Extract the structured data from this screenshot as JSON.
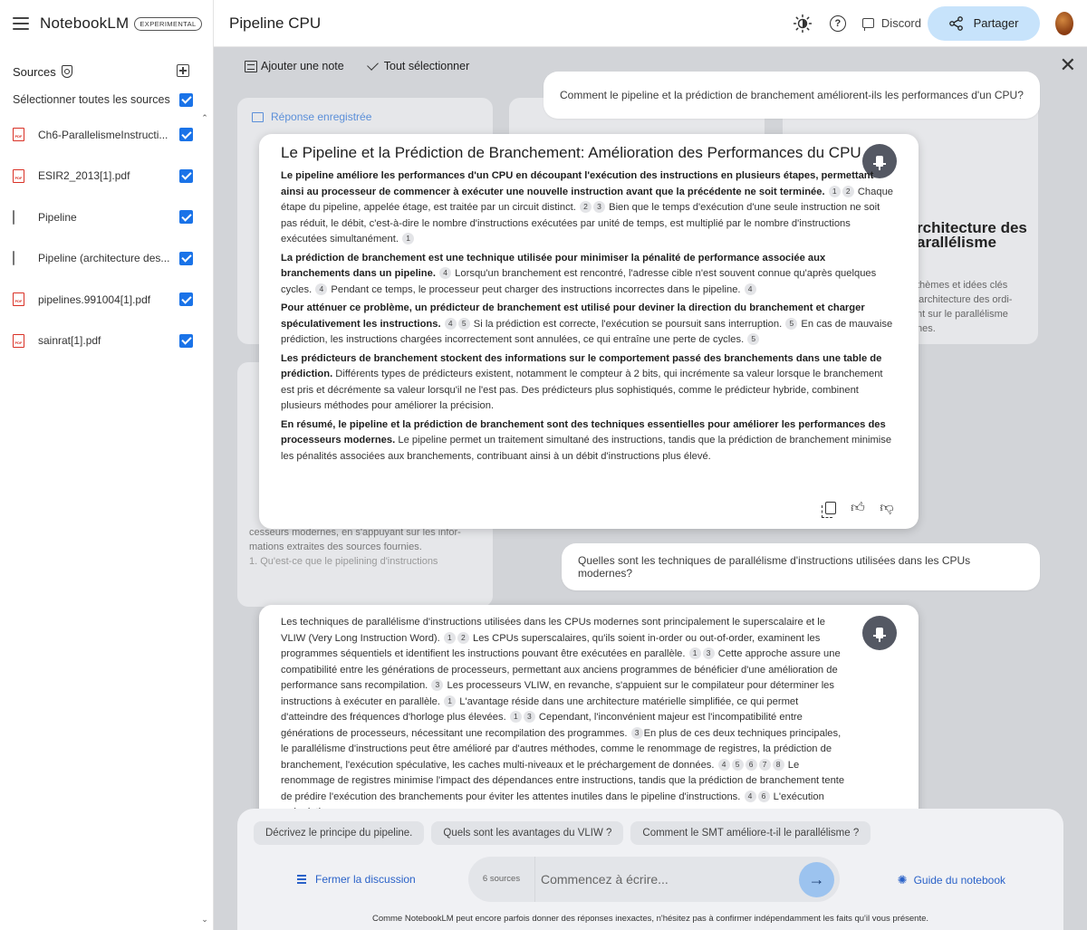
{
  "app": {
    "name": "NotebookLM",
    "badge": "EXPERIMENTAL"
  },
  "sidebar": {
    "sources_label": "Sources",
    "select_all_label": "Sélectionner toutes les sources",
    "items": [
      {
        "type": "pdf",
        "name": "Ch6-ParallelismeInstructi..."
      },
      {
        "type": "pdf",
        "name": "ESIR2_2013[1].pdf"
      },
      {
        "type": "web",
        "name": "Pipeline"
      },
      {
        "type": "web",
        "name": "Pipeline (architecture des..."
      },
      {
        "type": "pdf",
        "name": "pipelines.991004[1].pdf"
      },
      {
        "type": "pdf",
        "name": "sainrat[1].pdf"
      }
    ]
  },
  "header": {
    "title": "Pipeline CPU",
    "discord_label": "Discord",
    "share_label": "Partager"
  },
  "toolbar": {
    "add_note": "Ajouter une note",
    "select_all": "Tout sélectionner"
  },
  "background_cards": [
    {
      "header": "Réponse enregistrée",
      "title_partial": "Architecture des\nparallélisme",
      "body_partial": "thèmes et idées clés\narchitecture des ordi-\nnt sur le parallélisme\nnes."
    }
  ],
  "conversation": {
    "q1": "Comment le pipeline et la prédiction de branchement améliorent-ils les performances d'un CPU?",
    "a1_title": "Le Pipeline et la Prédiction de Branchement: Amélioration des Performances du CPU",
    "q2": "Quelles sont les techniques de parallélisme d'instructions utilisées dans les CPUs modernes?"
  },
  "bg_text": {
    "card1_header": "Réponse enregistrée",
    "card_partial_1": "cesseurs modernes, en s'appuyant sur les infor-",
    "card_partial_2": "mations extraites des sources fournies.",
    "card_partial_3": "1. Qu'est-ce que le pipelining d'instructions",
    "right_title_1": "rchitecture des",
    "right_title_2": "arallélisme",
    "right_body_1": "thèmes et idées clés",
    "right_body_2": "'architecture des ordi-",
    "right_body_3": "nt sur le parallélisme",
    "right_body_4": "nes."
  },
  "composer": {
    "chips": [
      "Décrivez le principe du pipeline.",
      "Quels sont les avantages du VLIW ?",
      "Comment le SMT améliore-t-il le parallélisme ?"
    ],
    "close_discussion": "Fermer la discussion",
    "source_count": "6 sources",
    "placeholder": "Commencez à écrire...",
    "guide_label": "Guide du notebook",
    "disclaimer": "Comme NotebookLM peut encore parfois donner des réponses inexactes, n'hésitez pas à confirmer indépendamment les faits qu'il vous présente."
  },
  "colors": {
    "accent": "#1a73e8",
    "share_bg": "#c7e3fb",
    "main_bg": "#d2d4d8",
    "link": "#2a62c8"
  }
}
